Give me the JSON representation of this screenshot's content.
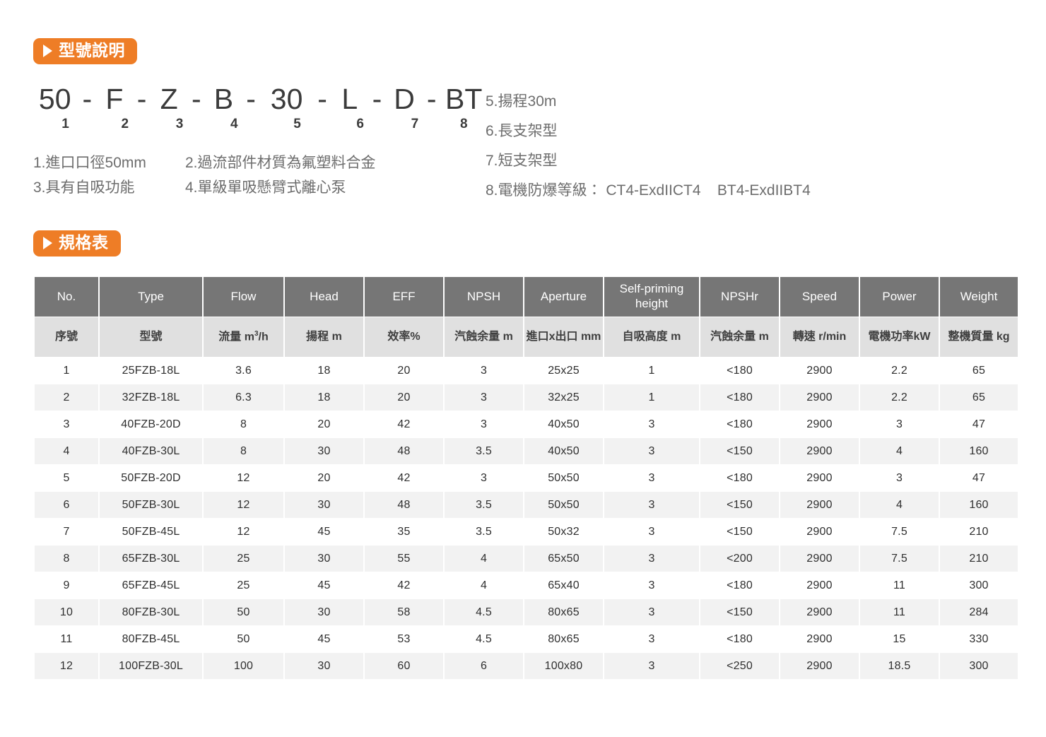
{
  "section_model": {
    "badge_label": "型號說明",
    "badge_icon": "play-triangle-icon",
    "code_segments": [
      "50",
      "F",
      "Z",
      "B",
      "30",
      "L",
      "D",
      "BT"
    ],
    "code_separator": "-",
    "index_numbers": [
      "1",
      "2",
      "3",
      "4",
      "5",
      "6",
      "7",
      "8"
    ],
    "notes_left": [
      {
        "a": "1.進口口徑50mm",
        "b": "2.過流部件材質為氟塑料合金"
      },
      {
        "a": "3.具有自吸功能",
        "b": "4.單級單吸懸臂式離心泵"
      }
    ],
    "notes_right": [
      "5.揚程30m",
      "6.長支架型",
      "7.短支架型",
      "8.電機防爆等級： CT4-ExdIICT4    BT4-ExdIIBT4"
    ]
  },
  "section_spec": {
    "badge_label": "規格表",
    "badge_icon": "play-triangle-icon",
    "headers_en": [
      "No.",
      "Type",
      "Flow",
      "Head",
      "EFF",
      "NPSH",
      "Aperture",
      "Self-priming height",
      "NPSHr",
      "Speed",
      "Power",
      "Weight"
    ],
    "headers_zh": [
      "序號",
      "型號",
      "流量 m³/h",
      "揚程 m",
      "效率%",
      "汽蝕余量 m",
      "進口x出口 mm",
      "自吸高度 m",
      "汽蝕余量 m",
      "轉速 r/min",
      "電機功率kW",
      "整機質量 kg"
    ],
    "rows": [
      [
        "1",
        "25FZB-18L",
        "3.6",
        "18",
        "20",
        "3",
        "25x25",
        "1",
        "<180",
        "2900",
        "2.2",
        "65"
      ],
      [
        "2",
        "32FZB-18L",
        "6.3",
        "18",
        "20",
        "3",
        "32x25",
        "1",
        "<180",
        "2900",
        "2.2",
        "65"
      ],
      [
        "3",
        "40FZB-20D",
        "8",
        "20",
        "42",
        "3",
        "40x50",
        "3",
        "<180",
        "2900",
        "3",
        "47"
      ],
      [
        "4",
        "40FZB-30L",
        "8",
        "30",
        "48",
        "3.5",
        "40x50",
        "3",
        "<150",
        "2900",
        "4",
        "160"
      ],
      [
        "5",
        "50FZB-20D",
        "12",
        "20",
        "42",
        "3",
        "50x50",
        "3",
        "<180",
        "2900",
        "3",
        "47"
      ],
      [
        "6",
        "50FZB-30L",
        "12",
        "30",
        "48",
        "3.5",
        "50x50",
        "3",
        "<150",
        "2900",
        "4",
        "160"
      ],
      [
        "7",
        "50FZB-45L",
        "12",
        "45",
        "35",
        "3.5",
        "50x32",
        "3",
        "<150",
        "2900",
        "7.5",
        "210"
      ],
      [
        "8",
        "65FZB-30L",
        "25",
        "30",
        "55",
        "4",
        "65x50",
        "3",
        "<200",
        "2900",
        "7.5",
        "210"
      ],
      [
        "9",
        "65FZB-45L",
        "25",
        "45",
        "42",
        "4",
        "65x40",
        "3",
        "<180",
        "2900",
        "11",
        "300"
      ],
      [
        "10",
        "80FZB-30L",
        "50",
        "30",
        "58",
        "4.5",
        "80x65",
        "3",
        "<150",
        "2900",
        "11",
        "284"
      ],
      [
        "11",
        "80FZB-45L",
        "50",
        "45",
        "53",
        "4.5",
        "80x65",
        "3",
        "<180",
        "2900",
        "15",
        "330"
      ],
      [
        "12",
        "100FZB-30L",
        "100",
        "30",
        "60",
        "6",
        "100x80",
        "3",
        "<250",
        "2900",
        "18.5",
        "300"
      ]
    ]
  },
  "colors": {
    "accent_orange": "#ee7d26",
    "header_dark": "#767676",
    "header_light": "#e0e0e0",
    "row_stripe": "#f2f2f2"
  }
}
